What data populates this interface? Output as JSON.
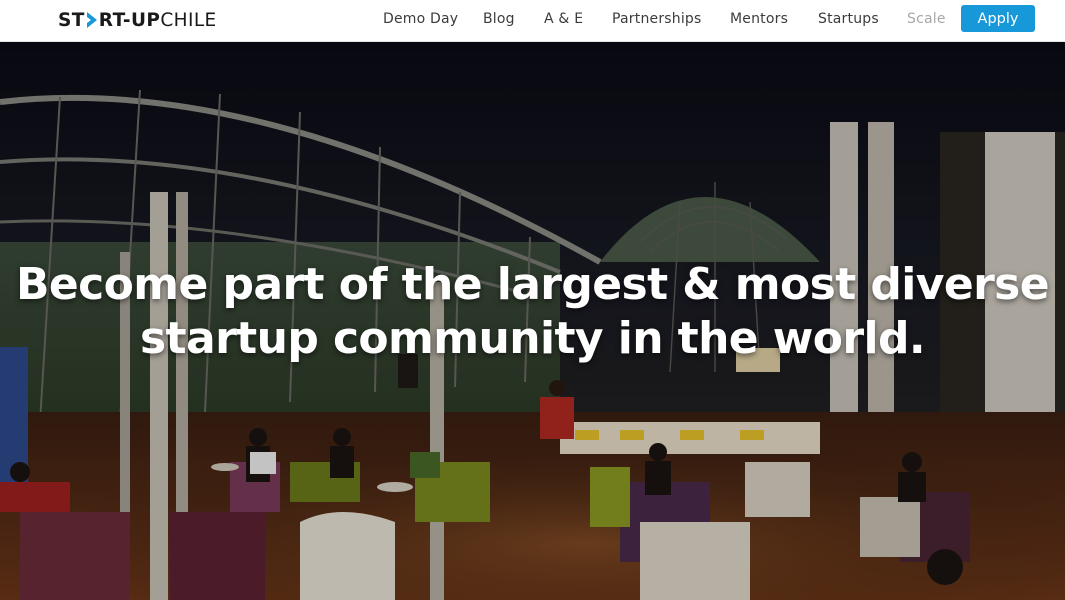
{
  "brand": {
    "logo_part1": "ST",
    "logo_part2": "RT-UP",
    "logo_part3": "CHILE",
    "accent_color": "#1798d8"
  },
  "nav": {
    "items": [
      {
        "label": "Demo Day"
      },
      {
        "label": "Blog"
      },
      {
        "label": "A & E"
      },
      {
        "label": "Partnerships"
      },
      {
        "label": "Mentors"
      },
      {
        "label": "Startups"
      },
      {
        "label": "Scale",
        "muted": true
      }
    ],
    "apply_label": "Apply"
  },
  "hero": {
    "line1": "Become part of the largest & most diverse",
    "line2": "startup community in the world."
  }
}
